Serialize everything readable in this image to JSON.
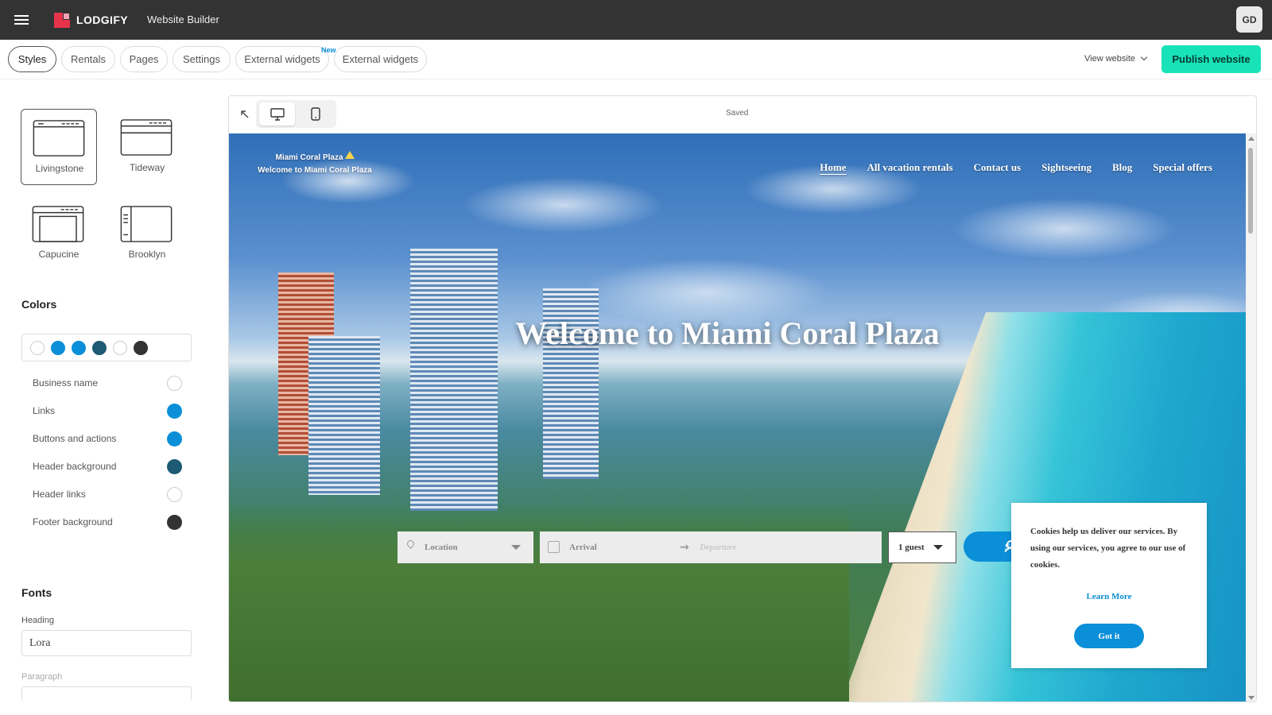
{
  "app": {
    "brand": "LODGIFY",
    "title": "Website Builder",
    "user_initials": "GD"
  },
  "tabs": [
    {
      "label": "Styles",
      "active": true
    },
    {
      "label": "Rentals"
    },
    {
      "label": "Pages"
    },
    {
      "label": "Settings"
    },
    {
      "label": "External widgets",
      "badge": "New"
    },
    {
      "label": "External widgets"
    }
  ],
  "toolbar": {
    "view_website": "View website",
    "publish": "Publish website"
  },
  "sidebar": {
    "layouts": [
      {
        "label": "Livingstone",
        "selected": true
      },
      {
        "label": "Tideway"
      },
      {
        "label": "Capucine"
      },
      {
        "label": "Brooklyn"
      }
    ],
    "colors_title": "Colors",
    "palette": [
      "#ffffff",
      "#0a8fd8",
      "#0a8fd8",
      "#1d5a73",
      "#ffffff",
      "#333333"
    ],
    "color_settings": [
      {
        "label": "Business name",
        "color": "#ffffff"
      },
      {
        "label": "Links",
        "color": "#0a8fd8"
      },
      {
        "label": "Buttons and actions",
        "color": "#0a8fd8"
      },
      {
        "label": "Header background",
        "color": "#1d5a73"
      },
      {
        "label": "Header links",
        "color": "#ffffff"
      },
      {
        "label": "Footer background",
        "color": "#333333"
      }
    ],
    "fonts_title": "Fonts",
    "heading_label": "Heading",
    "heading_font": "Lora",
    "paragraph_label": "Paragraph"
  },
  "preview": {
    "status": "Saved",
    "site": {
      "brand_line1": "Miami Coral Plaza",
      "brand_line2": "Welcome to Miami Coral Plaza",
      "nav": [
        "Home",
        "All vacation rentals",
        "Contact us",
        "Sightseeing",
        "Blog",
        "Special offers"
      ],
      "hero_title": "Welcome to Miami Coral Plaza",
      "search": {
        "location": "Location",
        "arrival": "Arrival",
        "departure": "Departure",
        "guests": "1 guest",
        "button": "Search"
      },
      "cookie": {
        "text": "Cookies help us deliver our services. By using our services, you agree to our use of cookies.",
        "learn_more": "Learn More",
        "got_it": "Got it"
      }
    }
  },
  "accent_colors": {
    "publish": "#18e3b8",
    "link_blue": "#0a8fd8",
    "topbar": "#333333"
  }
}
